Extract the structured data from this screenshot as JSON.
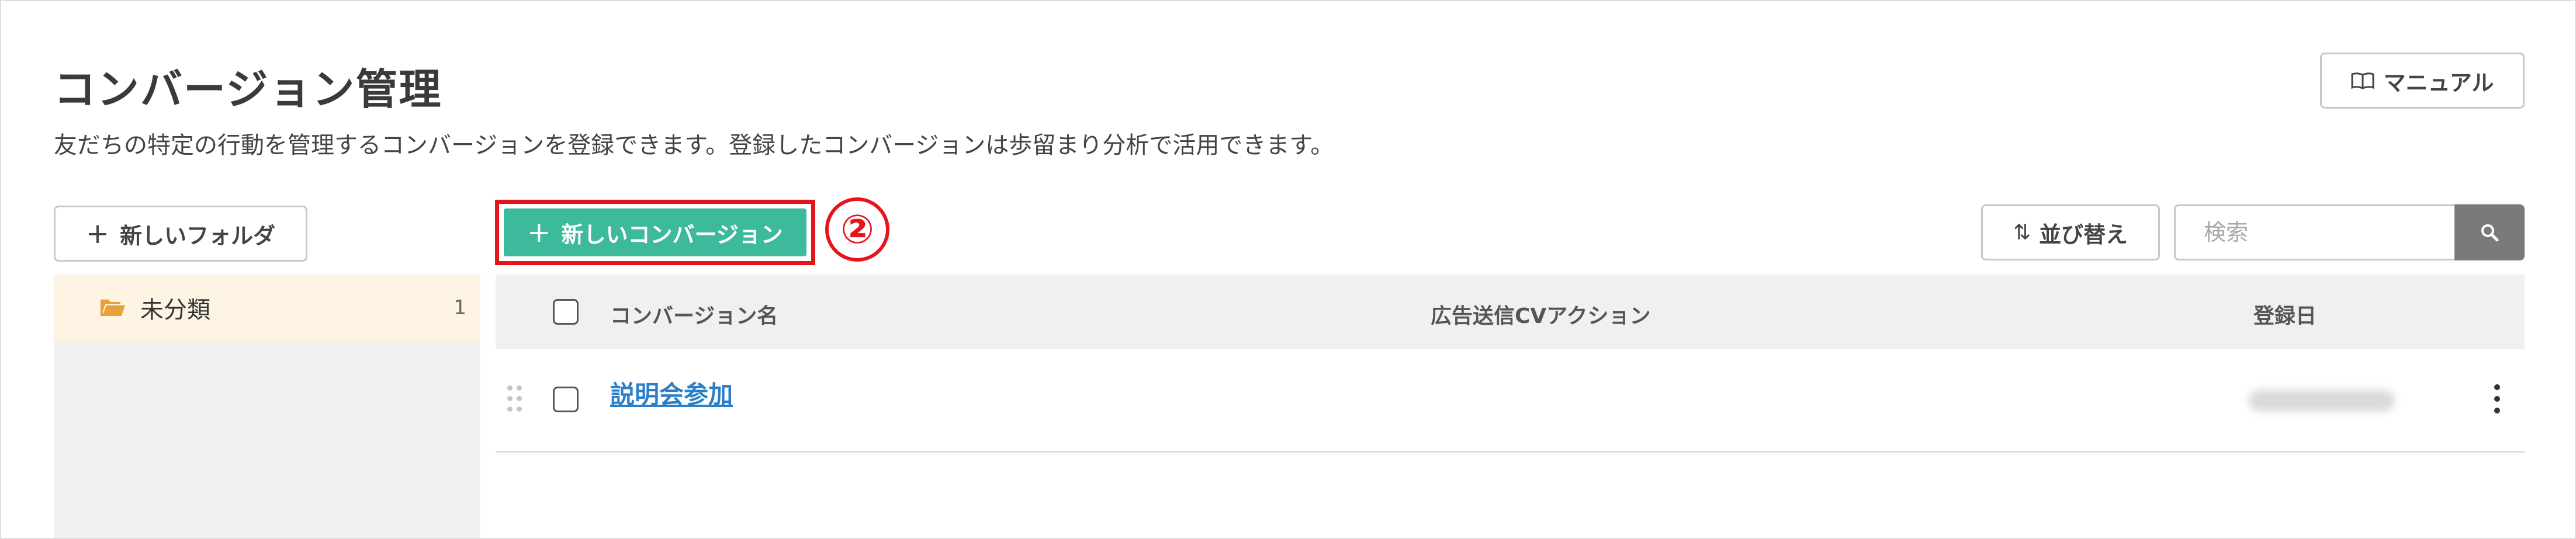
{
  "header": {
    "title": "コンバージョン管理",
    "description": "友だちの特定の行動を管理するコンバージョンを登録できます。登録したコンバージョンは歩留まり分析で活用できます。",
    "manual_button": {
      "label": "マニュアル",
      "icon": "book-icon"
    }
  },
  "toolbar": {
    "new_folder_label": "新しいフォルダ",
    "new_conversion_label": "新しいコンバージョン",
    "step_marker": "②",
    "sort_label": "並び替え",
    "search_placeholder": "検索"
  },
  "sidebar": {
    "folders": [
      {
        "label": "未分類",
        "count": "1",
        "icon": "folder-open-icon"
      }
    ]
  },
  "table": {
    "columns": [
      "コンバージョン名",
      "広告送信CVアクション",
      "登録日"
    ],
    "rows": [
      {
        "name": "説明会参加",
        "cv_action": "",
        "date": ""
      }
    ]
  },
  "colors": {
    "primary": "#3dba9b",
    "link": "#2a7fc8",
    "highlight": "#e6141b",
    "folder_active_bg": "#fdf4e3",
    "folder_icon": "#e9a23b"
  }
}
